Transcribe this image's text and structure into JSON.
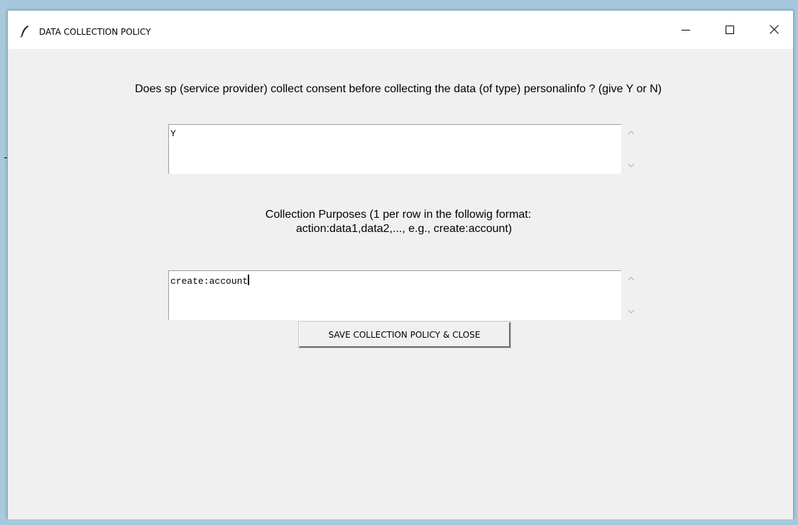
{
  "window": {
    "title": "DATA COLLECTION POLICY",
    "icon": "feather-icon",
    "controls": [
      "minimize-icon",
      "maximize-icon",
      "close-icon"
    ]
  },
  "form": {
    "question": "Does sp (service provider) collect consent before collecting the data (of type) personalinfo ? (give Y or N)",
    "consent_value": "Y",
    "purposes_label_line1": "Collection Purposes (1 per row in the followig format:",
    "purposes_label_line2": "action:data1,data2,..., e.g., create:account)",
    "purposes_value": "create:account",
    "save_label": "SAVE COLLECTION POLICY & CLOSE"
  }
}
